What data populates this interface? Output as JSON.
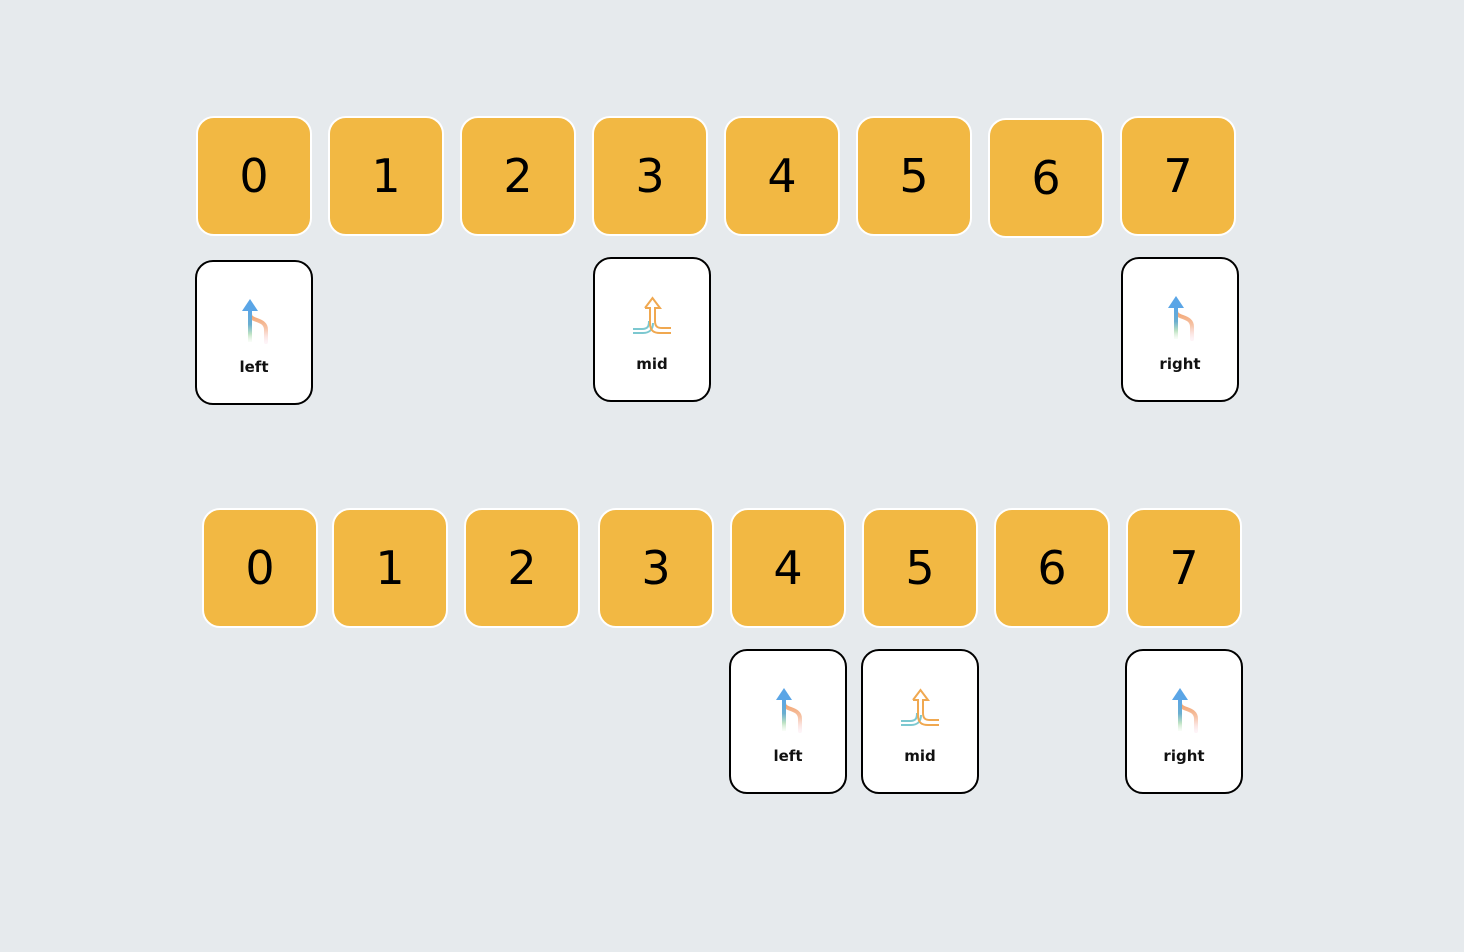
{
  "colors": {
    "background": "#e6eaed",
    "cell_fill": "#f2b843",
    "cell_border": "#ffffff",
    "pointer_fill": "#ffffff",
    "pointer_border": "#000000",
    "arrow_blue": "#5aa5e6",
    "curve_peach": "#f5b891",
    "merge_orange": "#f0a850",
    "merge_teal": "#7cc8d0"
  },
  "rows": [
    {
      "cells": [
        "0",
        "1",
        "2",
        "3",
        "4",
        "5",
        "6",
        "7"
      ],
      "pointers": [
        {
          "label": "left",
          "index": 0,
          "icon": "branch-up-arrow-icon"
        },
        {
          "label": "mid",
          "index": 3,
          "icon": "merge-arrow-icon"
        },
        {
          "label": "right",
          "index": 7,
          "icon": "branch-up-arrow-icon"
        }
      ]
    },
    {
      "cells": [
        "0",
        "1",
        "2",
        "3",
        "4",
        "5",
        "6",
        "7"
      ],
      "pointers": [
        {
          "label": "left",
          "index": 4,
          "icon": "branch-up-arrow-icon"
        },
        {
          "label": "mid",
          "index": 5,
          "icon": "merge-arrow-icon"
        },
        {
          "label": "right",
          "index": 7,
          "icon": "branch-up-arrow-icon"
        }
      ]
    }
  ]
}
